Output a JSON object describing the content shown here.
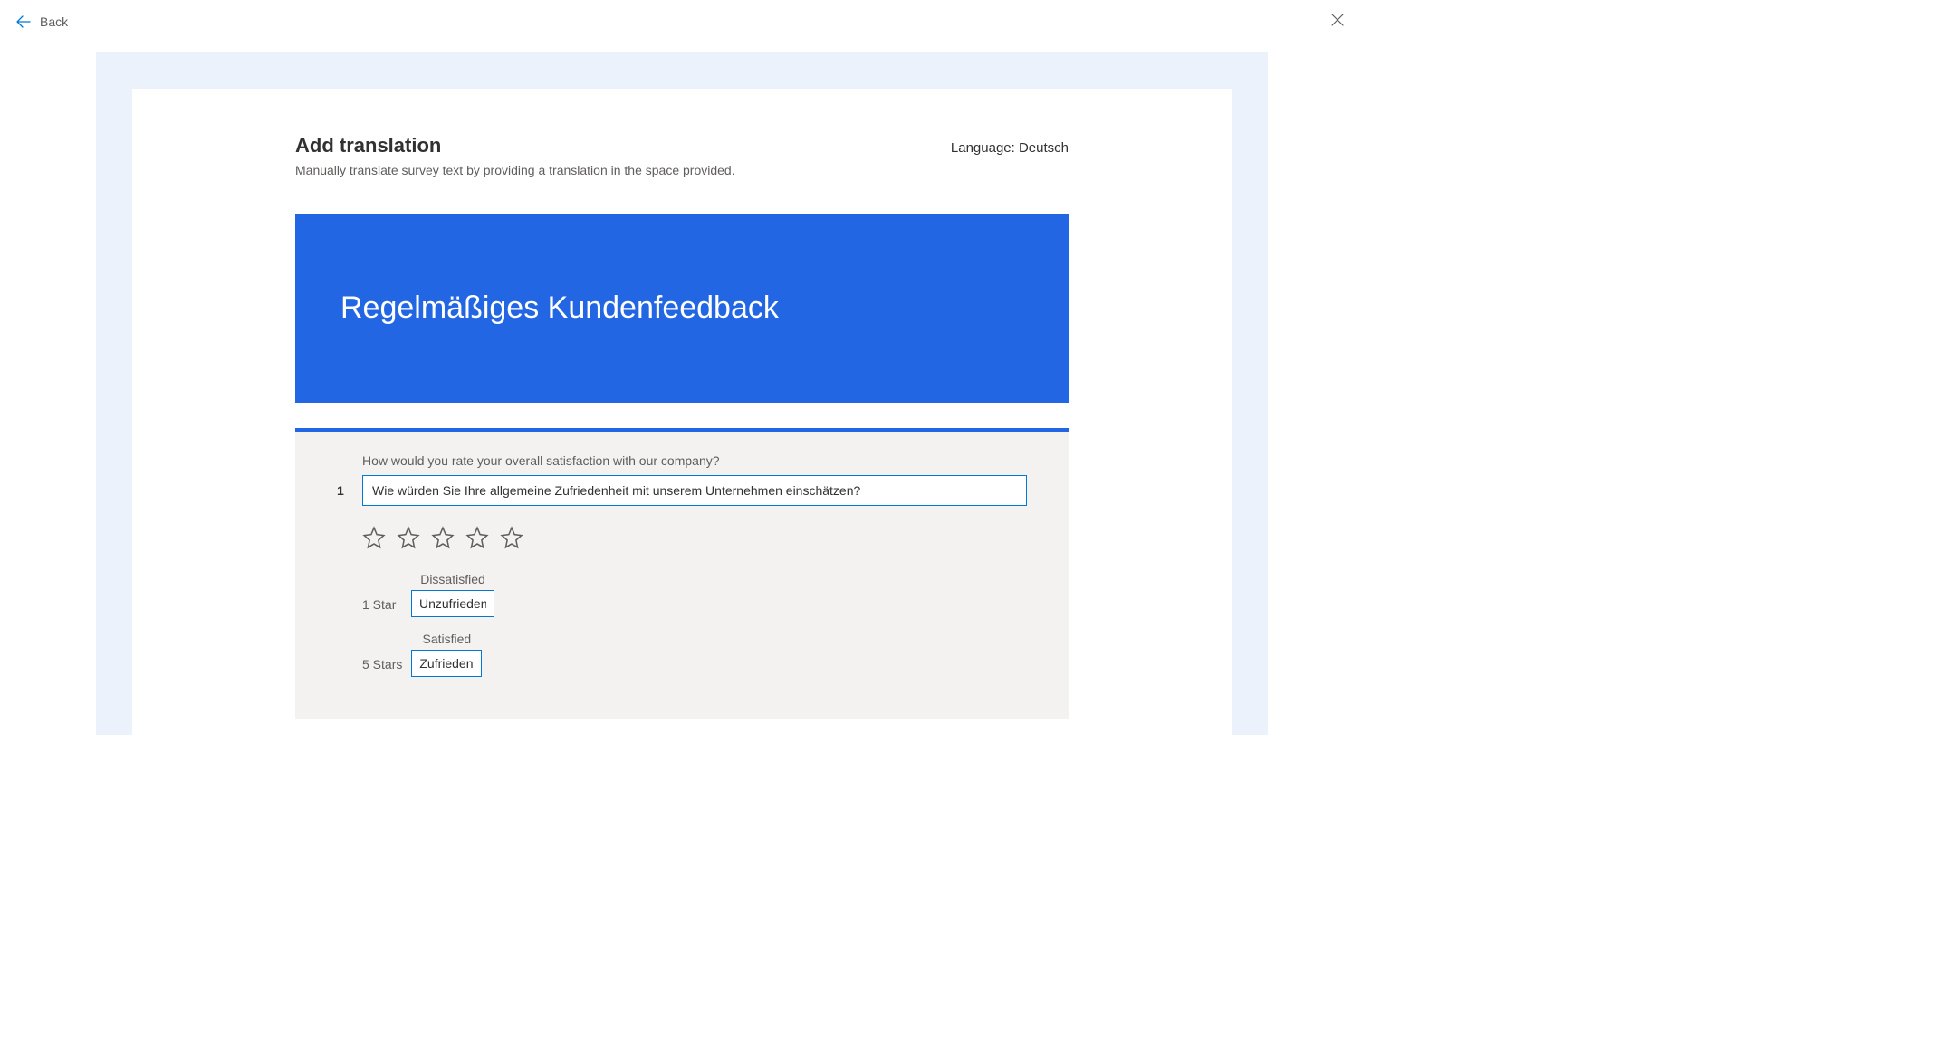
{
  "nav": {
    "back_label": "Back"
  },
  "header": {
    "title": "Add translation",
    "subtitle": "Manually translate survey text by providing a translation in the space provided.",
    "language_prefix": "Language: ",
    "language_value": "Deutsch"
  },
  "survey": {
    "banner_title": "Regelmäßiges Kundenfeedback"
  },
  "question1": {
    "number": "1",
    "original": "How would you rate your overall satisfaction with our company?",
    "translation": "Wie würden Sie Ihre allgemeine Zufriedenheit mit unserem Unternehmen einschätzen?",
    "ratings": {
      "low": {
        "left": "1 Star",
        "original": "Dissatisfied",
        "translation": "Unzufrieden"
      },
      "high": {
        "left": "5 Stars",
        "original": "Satisfied",
        "translation": "Zufrieden"
      }
    }
  }
}
